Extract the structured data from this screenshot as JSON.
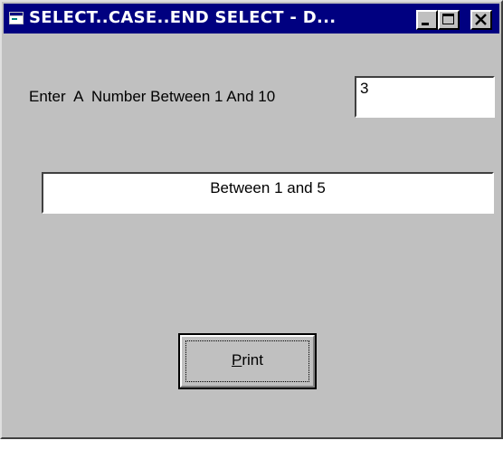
{
  "window": {
    "title": "SELECT..CASE..END SELECT  -  D...",
    "icon": "app-window-icon",
    "controls": [
      "minimize-icon",
      "maximize-icon",
      "close-icon"
    ]
  },
  "form": {
    "prompt_label": "Enter  A  Number Between 1 And 10",
    "number_input": {
      "value": "3",
      "placeholder": ""
    },
    "result_text": "Between 1 and 5",
    "print_button": {
      "accelerator": "P",
      "rest": "rint",
      "label": "Print"
    }
  },
  "colors": {
    "titlebar": "#000080",
    "face": "#c0c0c0",
    "field": "#ffffff"
  }
}
